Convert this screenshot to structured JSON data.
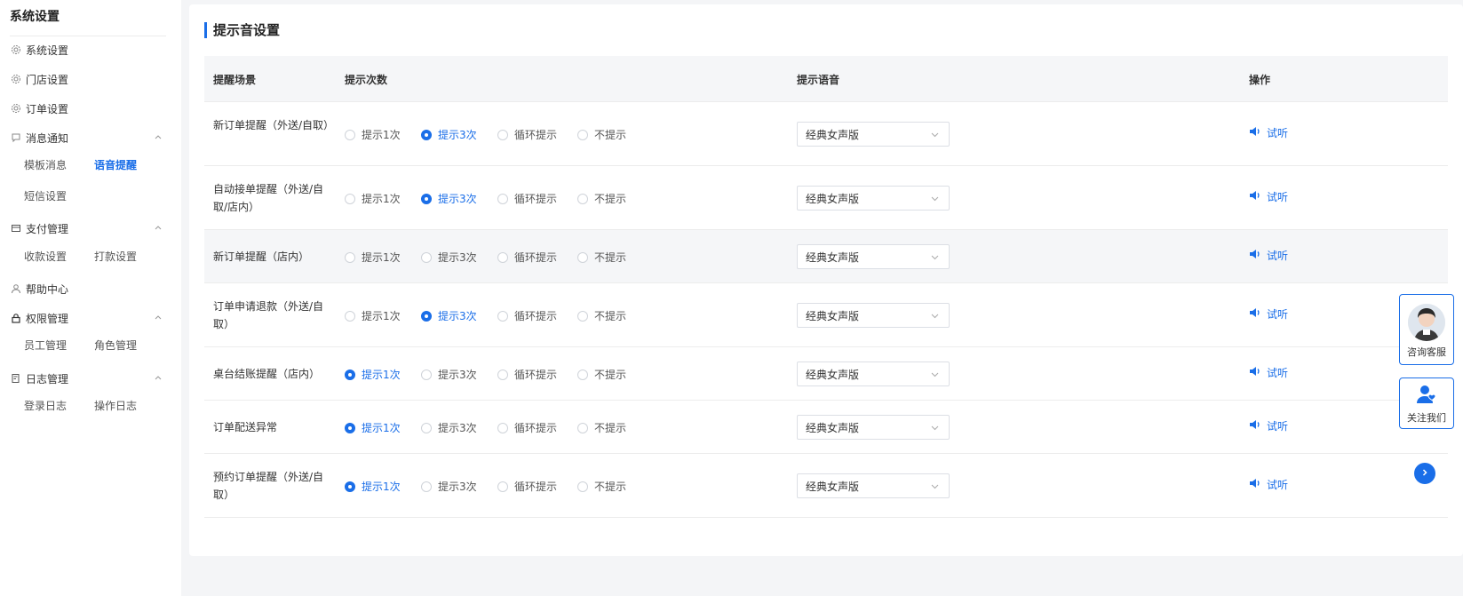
{
  "sidebar": {
    "title": "系统设置",
    "items": [
      {
        "label": "系统设置"
      },
      {
        "label": "门店设置"
      },
      {
        "label": "订单设置"
      },
      {
        "label": "消息通知",
        "subs": [
          "模板消息",
          "语音提醒",
          "短信设置"
        ]
      },
      {
        "label": "支付管理",
        "subs": [
          "收款设置",
          "打款设置"
        ]
      },
      {
        "label": "帮助中心"
      },
      {
        "label": "权限管理",
        "subs": [
          "员工管理",
          "角色管理"
        ]
      },
      {
        "label": "日志管理",
        "subs": [
          "登录日志",
          "操作日志"
        ]
      }
    ],
    "active_sub": "语音提醒"
  },
  "main": {
    "title": "提示音设置",
    "columns": [
      "提醒场景",
      "提示次数",
      "提示语音",
      "操作"
    ],
    "radio_options": [
      "提示1次",
      "提示3次",
      "循环提示",
      "不提示"
    ],
    "rows": [
      {
        "scene": "新订单提醒（外送/自取）",
        "selected": 1,
        "voice": "经典女声版",
        "action": "试听"
      },
      {
        "scene": "自动接单提醒（外送/自取/店内）",
        "selected": 1,
        "voice": "经典女声版",
        "action": "试听"
      },
      {
        "scene": "新订单提醒（店内）",
        "selected": -1,
        "voice": "经典女声版",
        "action": "试听"
      },
      {
        "scene": "订单申请退款（外送/自取）",
        "selected": 1,
        "voice": "经典女声版",
        "action": "试听"
      },
      {
        "scene": "桌台结账提醒（店内）",
        "selected": 0,
        "voice": "经典女声版",
        "action": "试听"
      },
      {
        "scene": "订单配送异常",
        "selected": 0,
        "voice": "经典女声版",
        "action": "试听"
      },
      {
        "scene": "预约订单提醒（外送/自取）",
        "selected": 0,
        "voice": "经典女声版",
        "action": "试听"
      }
    ]
  },
  "float": {
    "consult_label": "咨询客服",
    "follow_label": "关注我们"
  },
  "colors": {
    "accent": "#1a6ee8",
    "header_bg": "#f5f6f8"
  }
}
